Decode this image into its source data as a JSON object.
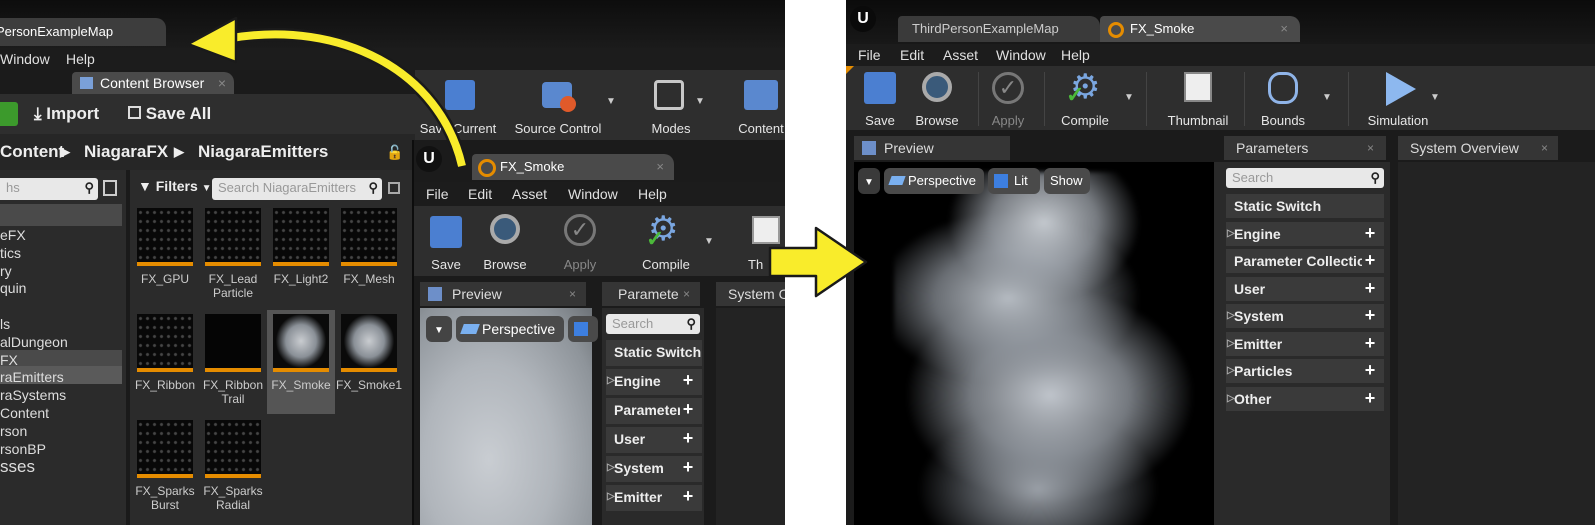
{
  "left": {
    "tab_title": "PersonExampleMap",
    "menu": [
      "Window",
      "Help"
    ],
    "content_browser": {
      "tab": "Content Browser",
      "import_label": "Import",
      "save_all_label": "Save All",
      "breadcrumb": [
        "Content",
        "NiagaraFX",
        "NiagaraEmitters"
      ],
      "search_placeholder": "hs",
      "filters_label": "Filters",
      "asset_search_placeholder": "Search NiagaraEmitters",
      "tree": [
        "eFX",
        "tics",
        "ry",
        "quin",
        "",
        "ls",
        "alDungeon",
        "FX",
        "raEmitters",
        "raSystems",
        "Content",
        "rson",
        "rsonBP"
      ],
      "tree_footer": "sses",
      "assets": [
        {
          "label": "FX_GPU"
        },
        {
          "label": "FX_Lead Particle"
        },
        {
          "label": "FX_Light2"
        },
        {
          "label": "FX_Mesh"
        },
        {
          "label": "FX_Ribbon"
        },
        {
          "label": "FX_Ribbon Trail"
        },
        {
          "label": "FX_Smoke"
        },
        {
          "label": "FX_Smoke1"
        },
        {
          "label": "FX_Sparks Burst"
        },
        {
          "label": "FX_Sparks Radial"
        }
      ]
    },
    "level_toolbar": [
      "Save Current",
      "Source Control",
      "Modes",
      "Content"
    ],
    "editor": {
      "tab": "FX_Smoke",
      "menu": [
        "File",
        "Edit",
        "Asset",
        "Window",
        "Help"
      ],
      "toolbar": [
        "Save",
        "Browse",
        "Apply",
        "Compile",
        "Th"
      ],
      "preview_tab": "Preview",
      "params_tab": "Paramete",
      "system_tab": "System O",
      "perspective": "Perspective",
      "search_placeholder": "Search",
      "params": [
        "Static Switch",
        "Engine",
        "Parameter",
        "User",
        "System",
        "Emitter"
      ]
    }
  },
  "right": {
    "tabs": [
      "ThirdPersonExampleMap",
      "FX_Smoke"
    ],
    "menu": [
      "File",
      "Edit",
      "Asset",
      "Window",
      "Help"
    ],
    "toolbar": [
      "Save",
      "Browse",
      "Apply",
      "Compile",
      "Thumbnail",
      "Bounds",
      "Simulation"
    ],
    "preview_tab": "Preview",
    "params_tab": "Parameters",
    "system_tab": "System Overview",
    "viewport": {
      "perspective": "Perspective",
      "lit": "Lit",
      "show": "Show"
    },
    "search_placeholder": "Search",
    "params": [
      {
        "label": "Static Switch",
        "expandable": false,
        "plus": false
      },
      {
        "label": "Engine",
        "expandable": true,
        "plus": true
      },
      {
        "label": "Parameter Collection",
        "expandable": false,
        "plus": true
      },
      {
        "label": "User",
        "expandable": false,
        "plus": true
      },
      {
        "label": "System",
        "expandable": true,
        "plus": true
      },
      {
        "label": "Emitter",
        "expandable": true,
        "plus": true
      },
      {
        "label": "Particles",
        "expandable": true,
        "plus": true
      },
      {
        "label": "Other",
        "expandable": true,
        "plus": true
      }
    ]
  },
  "colors": {
    "accent": "#e58c00",
    "arrow": "#f9ec2b",
    "panel": "#2a2a2a"
  }
}
